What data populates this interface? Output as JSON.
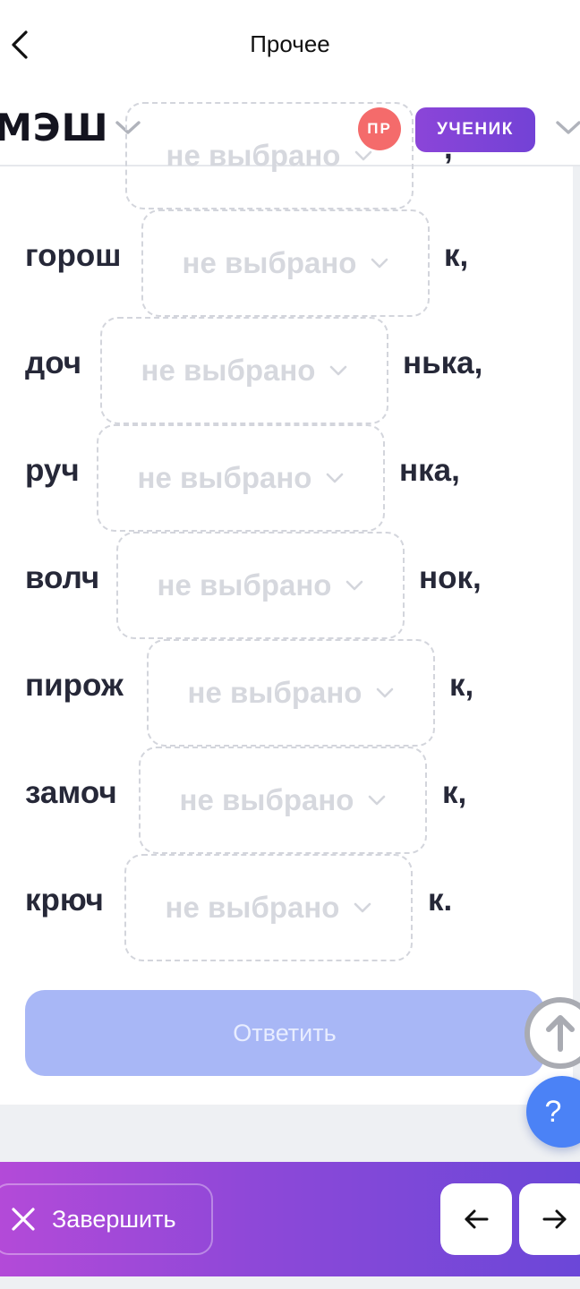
{
  "topbar": {
    "title": "Прочее"
  },
  "header": {
    "logo": "МЭШ",
    "avatar_initials": "ПР",
    "role": "УЧЕНИК"
  },
  "exercise": {
    "placeholder": "не выбрано",
    "partial_top_suffix": ",",
    "rows": [
      {
        "prefix": "горош",
        "suffix": "к,"
      },
      {
        "prefix": "доч",
        "suffix": "нька,"
      },
      {
        "prefix": "руч",
        "suffix": "нка,"
      },
      {
        "prefix": "волч",
        "suffix": "нок,"
      },
      {
        "prefix": "пирож",
        "suffix": "к,"
      },
      {
        "prefix": "замоч",
        "suffix": "к,"
      },
      {
        "prefix": "крюч",
        "suffix": "к."
      }
    ],
    "answer_label": "Ответить"
  },
  "help": {
    "label": "?"
  },
  "bottom_bar": {
    "finish_label": "Завершить"
  },
  "colors": {
    "accent": "#7342d6",
    "answer_disabled": "#a8b7f6",
    "avatar": "#f46b6b",
    "help": "#4b82f6"
  }
}
